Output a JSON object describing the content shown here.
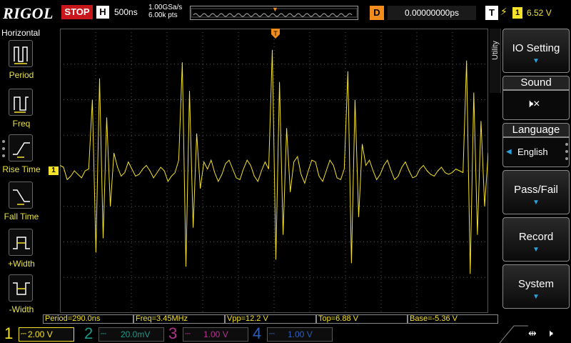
{
  "brand": "RIGOL",
  "run_status": "STOP",
  "horizontal": {
    "badge": "H",
    "timebase": "500ns",
    "sample_rate": "1.00GSa/s",
    "mem_depth": "6.00k pts"
  },
  "delay": {
    "badge": "D",
    "value": "0.00000000ps"
  },
  "trigger": {
    "badge": "T",
    "channel": "1",
    "level": "6.52 V"
  },
  "left_panel": {
    "title": "Horizontal",
    "items": [
      {
        "label": "Period",
        "icon": "period-icon"
      },
      {
        "label": "Freq",
        "icon": "freq-icon"
      },
      {
        "label": "Rise Time",
        "icon": "rise-time-icon"
      },
      {
        "label": "Fall Time",
        "icon": "fall-time-icon"
      },
      {
        "label": "+Width",
        "icon": "pos-width-icon"
      },
      {
        "label": "-Width",
        "icon": "neg-width-icon"
      }
    ]
  },
  "measurements": [
    "Period=290.0ns",
    "Freq=3.45MHz",
    "Vpp=12.2 V",
    "Top=6.88 V",
    "Base=-5.36 V"
  ],
  "channels": [
    {
      "num": "1",
      "scale": "2.00 V",
      "color": "#f5e22b",
      "coupling_icon": "dc-coupling-icon"
    },
    {
      "num": "2",
      "scale": "20.0mV",
      "color": "#1a9a8a",
      "coupling_icon": "dc-coupling-icon"
    },
    {
      "num": "3",
      "scale": "1.00 V",
      "color": "#b0338f",
      "coupling_icon": "dc-coupling-icon"
    },
    {
      "num": "4",
      "scale": "1.00 V",
      "color": "#2f5fb8",
      "coupling_icon": "dc-coupling-icon"
    }
  ],
  "ch1_marker": "1",
  "right_menu": {
    "tab": "Utility",
    "io_setting": "IO Setting",
    "sound": "Sound",
    "language": "Language",
    "language_value": "English",
    "pass_fail": "Pass/Fail",
    "record": "Record",
    "system": "System"
  },
  "colors": {
    "ch1": "#f5e22b",
    "trigger": "#f28c1d",
    "stop": "#c8161d",
    "menu_arrow": "#2aa3e0"
  },
  "chart_data": {
    "type": "line",
    "series": [
      {
        "values": [
          0.3,
          0.2,
          -0.5,
          -0.3,
          0.0,
          -0.2,
          -0.4,
          0.0,
          0.1,
          4.0,
          -4.6,
          5.2,
          -3.8,
          3.0,
          -2.0,
          1.0,
          0.2,
          -0.3,
          -0.1,
          0.5,
          0.1,
          -0.3,
          -0.2,
          0.1,
          0.3,
          0.0,
          -0.4,
          -0.1,
          0.2,
          0.0,
          -0.6,
          -0.3,
          -0.1,
          0.6,
          6.1,
          -5.4,
          4.5,
          -3.2,
          2.1,
          -1.0,
          0.5,
          0.1,
          0.6,
          -0.1,
          -0.6,
          -0.2,
          0.4,
          0.6,
          0.1,
          -0.4,
          -0.5,
          0.1,
          0.6,
          0.3,
          -0.3,
          -0.6,
          0.0,
          0.5,
          0.1,
          6.8,
          -5.0,
          5.0,
          -3.6,
          2.4,
          -1.2,
          0.5,
          0.8,
          -0.2,
          -0.7,
          0.0,
          0.6,
          0.5,
          -0.3,
          -0.6,
          0.0,
          0.6,
          0.3,
          -0.4,
          -0.5,
          0.1,
          5.6,
          -5.2,
          4.0,
          -2.6,
          1.5,
          0.3,
          0.6,
          0.0,
          -0.5,
          -0.2,
          0.3,
          0.6,
          0.0,
          -0.5,
          -0.3,
          0.2,
          0.5,
          0.0,
          -0.4,
          -0.3,
          0.1,
          0.3,
          0.0,
          -0.2,
          -0.3,
          0.0,
          0.2,
          -0.1,
          -0.2,
          -0.1,
          0.1,
          0.0,
          -0.1,
          6.2,
          -5.8,
          4.4,
          -3.6,
          2.8,
          -2.0,
          1.0
        ]
      }
    ]
  }
}
